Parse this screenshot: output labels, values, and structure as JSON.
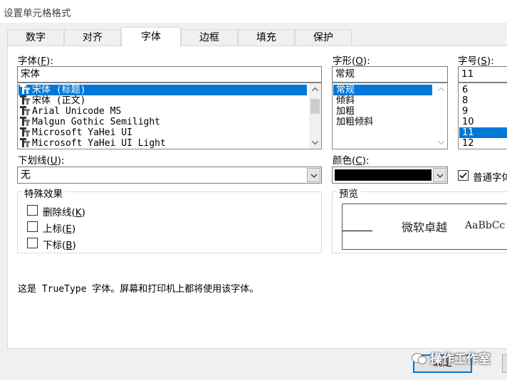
{
  "window": {
    "title": "设置单元格格式"
  },
  "tabs": [
    "数字",
    "对齐",
    "字体",
    "边框",
    "填充",
    "保护"
  ],
  "font": {
    "label": "字体(",
    "hotkey": "F",
    "label_end": "):",
    "value": "宋体",
    "items": [
      "宋体 (标题)",
      "宋体 (正文)",
      "Arial Unicode MS",
      "Malgun Gothic Semilight",
      "Microsoft YaHei UI",
      "Microsoft YaHei UI Light"
    ]
  },
  "style": {
    "label": "字形(",
    "hotkey": "O",
    "label_end": "):",
    "value": "常规",
    "items": [
      "常规",
      "倾斜",
      "加粗",
      "加粗倾斜"
    ]
  },
  "size": {
    "label": "字号(",
    "hotkey": "S",
    "label_end": "):",
    "value": "11",
    "items": [
      "6",
      "8",
      "9",
      "10",
      "11",
      "12"
    ]
  },
  "underline": {
    "label": "下划线(",
    "hotkey": "U",
    "label_end": "):",
    "value": "无"
  },
  "color": {
    "label": "颜色(",
    "hotkey": "C",
    "label_end": "):",
    "swatch": "#000000"
  },
  "normal_font": {
    "label": "普通字体",
    "checked": true
  },
  "effects": {
    "title": "特殊效果",
    "items": [
      {
        "label": "删除线(",
        "hotkey": "K",
        "label_end": ")",
        "checked": false
      },
      {
        "label": "上标(",
        "hotkey": "E",
        "label_end": ")",
        "checked": false
      },
      {
        "label": "下标(",
        "hotkey": "B",
        "label_end": ")",
        "checked": false
      }
    ]
  },
  "preview": {
    "title": "预览",
    "sample_cn": "微软卓越",
    "sample_en": "AaBbCc"
  },
  "info": "这是 TrueType 字体。屏幕和打印机上都将使用该字体。",
  "buttons": {
    "ok": "确定"
  },
  "watermark": "操作工作室",
  "colors": {
    "accent": "#0078d7",
    "selection": "#0078d7"
  }
}
